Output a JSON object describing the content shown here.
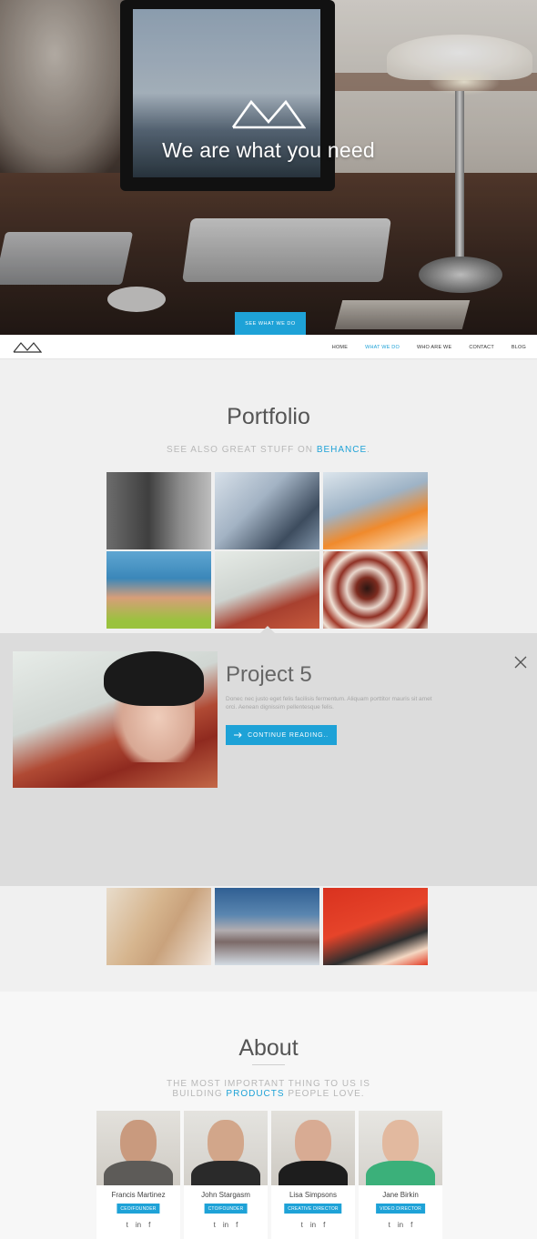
{
  "hero": {
    "title": "We are what you need",
    "cta_label": "SEE WHAT WE DO",
    "logo_icon": "mountain-logo-icon"
  },
  "nav": {
    "logo_icon": "mountain-logo-icon",
    "items": [
      {
        "label": "HOME",
        "active": false
      },
      {
        "label": "WHAT WE DO",
        "active": true
      },
      {
        "label": "WHO ARE WE",
        "active": false
      },
      {
        "label": "CONTACT",
        "active": false
      },
      {
        "label": "BLOG",
        "active": false
      }
    ]
  },
  "portfolio": {
    "title": "Portfolio",
    "subtitle_prefix": "SEE ALSO GREAT STUFF ON ",
    "subtitle_link": "BEHANCE",
    "subtitle_suffix": "."
  },
  "project": {
    "title": "Project 5",
    "description": "Donec nec justo eget felis facilisis fermentum. Aliquam porttitor mauris sit amet orci. Aenean dignissim pellentesque felis.",
    "button_icon": "arrow-right-icon",
    "button_label": "CONTINUE READING..",
    "close_icon": "close-icon"
  },
  "about": {
    "title": "About",
    "subtitle_line1": "THE MOST IMPORTANT THING TO US IS",
    "subtitle_line2_prefix": "BUILDING ",
    "subtitle_link": "PRODUCTS",
    "subtitle_line2_suffix": " PEOPLE LOVE.",
    "team": [
      {
        "name": "Francis Martinez",
        "role": "CEO/FOUNDER"
      },
      {
        "name": "John Stargasm",
        "role": "CTO/FOUNDER"
      },
      {
        "name": "Lisa Simpsons",
        "role": "CREATIVE DIRECTOR"
      },
      {
        "name": "Jane Birkin",
        "role": "VIDEO DIRECTOR"
      }
    ],
    "social": {
      "twitter": "t",
      "linkedin": "in",
      "facebook": "f"
    }
  },
  "colors": {
    "accent": "#1ea2d7",
    "page_bg": "#f0f0f0",
    "panel_bg": "#dcdcdc"
  }
}
